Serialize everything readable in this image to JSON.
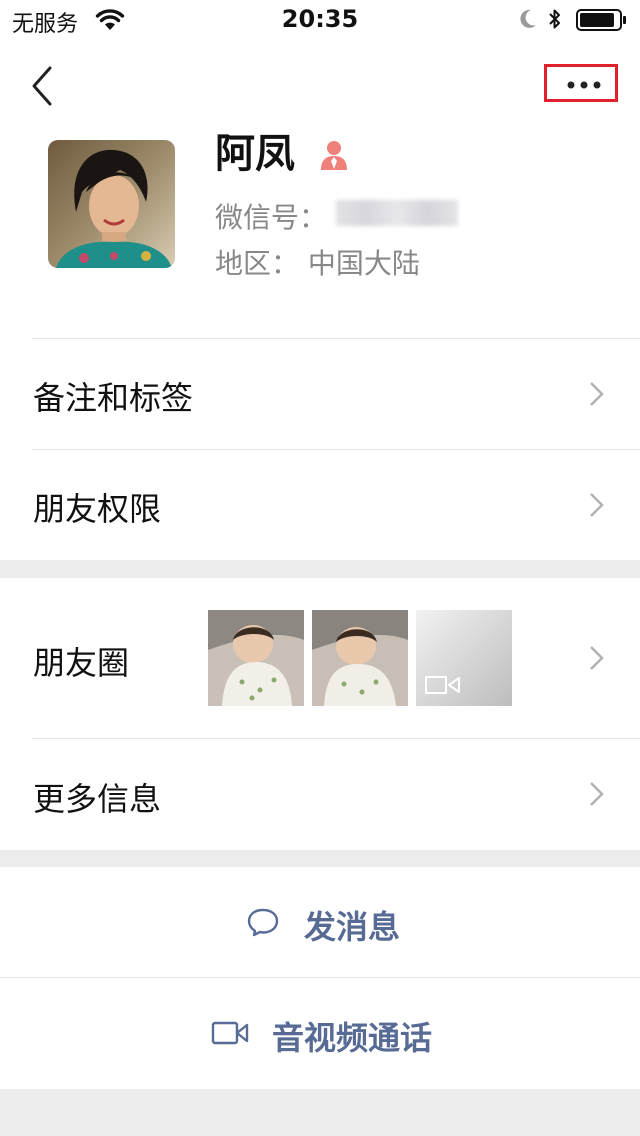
{
  "status_bar": {
    "carrier": "无服务",
    "time": "20:35"
  },
  "profile": {
    "name": "阿凤",
    "wechat_id_label": "微信号：",
    "region_label": "地区：  中国大陆"
  },
  "menu": {
    "remark_tags": "备注和标签",
    "friend_permissions": "朋友权限",
    "moments": "朋友圈",
    "more_info": "更多信息"
  },
  "actions": {
    "send_message": "发消息",
    "video_call": "音视频通话"
  },
  "icons": {
    "back": "chevron-left-icon",
    "more": "ellipsis-icon",
    "gender": "female-icon",
    "chevron": "chevron-right-icon",
    "message": "chat-bubble-icon",
    "video": "video-camera-icon"
  },
  "colors": {
    "link": "#576b95",
    "highlight_box": "#e0202a",
    "female": "#f0807a",
    "background": "#ededed"
  }
}
